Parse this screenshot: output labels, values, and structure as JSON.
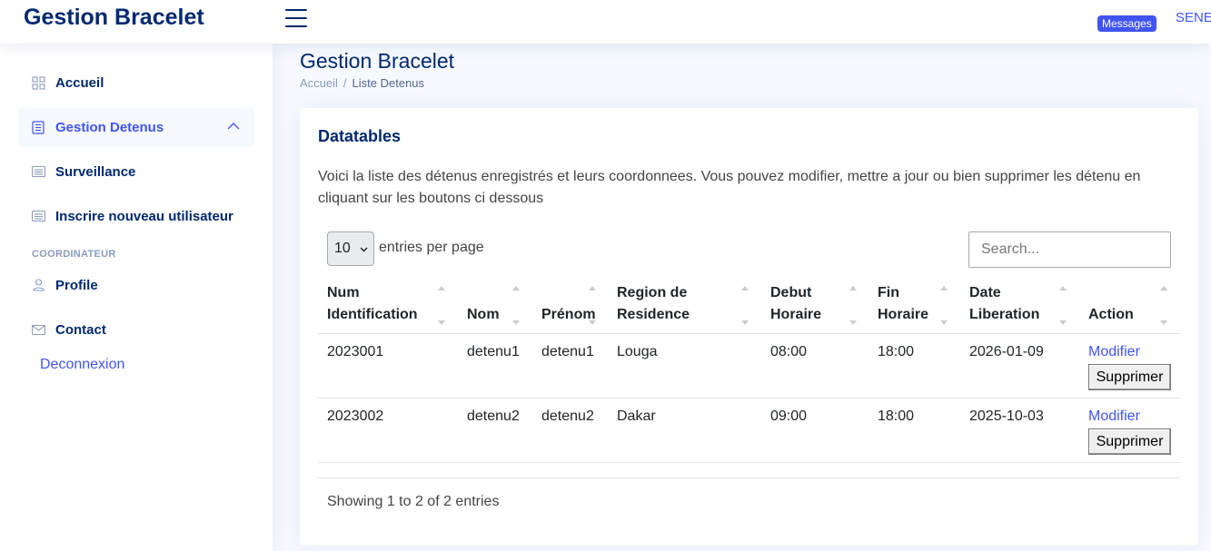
{
  "header": {
    "brand": "Gestion Bracelet",
    "messages_badge": "Messages",
    "user_name": "SENE"
  },
  "sidebar": {
    "items": [
      {
        "label": "Accueil",
        "icon": "grid-icon"
      },
      {
        "label": "Gestion Detenus",
        "icon": "list-icon",
        "active": true
      },
      {
        "label": "Surveillance",
        "icon": "card-icon"
      },
      {
        "label": "Inscrire nouveau utilisateur",
        "icon": "card-icon"
      }
    ],
    "heading": "COORDINATEUR",
    "items2": [
      {
        "label": "Profile",
        "icon": "person-icon"
      },
      {
        "label": "Contact",
        "icon": "envelope-icon"
      }
    ],
    "logout": "Deconnexion"
  },
  "page": {
    "title": "Gestion Bracelet",
    "breadcrumb": [
      "Accueil",
      "Liste Detenus"
    ]
  },
  "card": {
    "title": "Datatables",
    "description": "Voici la liste des détenus enregistrés et leurs coordonnees. Vous pouvez modifier, mettre a jour ou bien supprimer les détenu en cliquant sur les boutons ci dessous"
  },
  "datatable": {
    "per_page_value": "10",
    "per_page_label": "entries per page",
    "search_placeholder": "Search...",
    "columns": [
      {
        "line1": "Num",
        "line2": "Identification"
      },
      {
        "line1": "",
        "line2": "Nom"
      },
      {
        "line1": "",
        "line2": "Prénom"
      },
      {
        "line1": "Region de",
        "line2": "Residence"
      },
      {
        "line1": "Debut",
        "line2": "Horaire"
      },
      {
        "line1": "Fin",
        "line2": "Horaire"
      },
      {
        "line1": "Date",
        "line2": "Liberation"
      },
      {
        "line1": "",
        "line2": "Action"
      }
    ],
    "rows": [
      {
        "num": "2023001",
        "nom": "detenu1",
        "prenom": "detenu1",
        "region": "Louga",
        "debut": "08:00",
        "fin": "18:00",
        "date": "2026-01-09",
        "modifier": "Modifier",
        "supprimer": "Supprimer"
      },
      {
        "num": "2023002",
        "nom": "detenu2",
        "prenom": "detenu2",
        "region": "Dakar",
        "debut": "09:00",
        "fin": "18:00",
        "date": "2025-10-03",
        "modifier": "Modifier",
        "supprimer": "Supprimer"
      }
    ],
    "showing": "Showing 1 to 2 of 2 entries"
  },
  "colors": {
    "primary": "#4154f1",
    "navy": "#012970",
    "background": "#f6f9ff"
  }
}
